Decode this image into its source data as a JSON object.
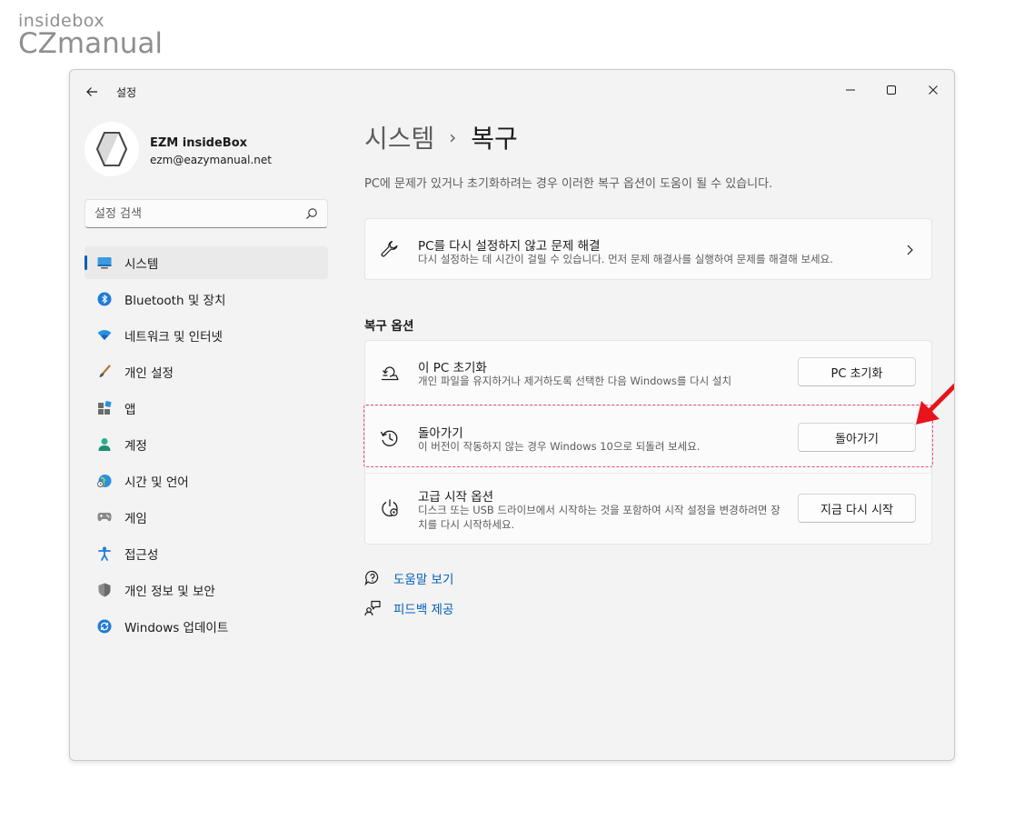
{
  "watermark": {
    "top": "insidebox",
    "bottom": "CZmanual"
  },
  "window": {
    "title": "설정"
  },
  "profile": {
    "name": "EZM insideBox",
    "email": "ezm@eazymanual.net"
  },
  "search": {
    "placeholder": "설정 검색"
  },
  "sidebar": {
    "items": [
      {
        "label": "시스템",
        "icon": "system-icon",
        "active": true
      },
      {
        "label": "Bluetooth 및 장치",
        "icon": "bluetooth-icon"
      },
      {
        "label": "네트워크 및 인터넷",
        "icon": "wifi-icon"
      },
      {
        "label": "개인 설정",
        "icon": "brush-icon"
      },
      {
        "label": "앱",
        "icon": "apps-icon"
      },
      {
        "label": "계정",
        "icon": "account-icon"
      },
      {
        "label": "시간 및 언어",
        "icon": "globe-icon"
      },
      {
        "label": "게임",
        "icon": "gamepad-icon"
      },
      {
        "label": "접근성",
        "icon": "accessibility-icon"
      },
      {
        "label": "개인 정보 및 보안",
        "icon": "shield-icon"
      },
      {
        "label": "Windows 업데이트",
        "icon": "update-icon"
      }
    ]
  },
  "main": {
    "breadcrumb_parent": "시스템",
    "breadcrumb_sep": "›",
    "breadcrumb_current": "복구",
    "description": "PC에 문제가 있거나 초기화하려는 경우 이러한 복구 옵션이 도움이 될 수 있습니다.",
    "troubleshoot": {
      "title": "PC를 다시 설정하지 않고 문제 해결",
      "subtitle": "다시 설정하는 데 시간이 걸릴 수 있습니다. 먼저 문제 해결사를 실행하여 문제를 해결해 보세요."
    },
    "recovery_header": "복구 옵션",
    "options": [
      {
        "title": "이 PC 초기화",
        "subtitle": "개인 파일을 유지하거나 제거하도록 선택한 다음 Windows를 다시 설치",
        "button": "PC 초기화"
      },
      {
        "title": "돌아가기",
        "subtitle": "이 버전이 작동하지 않는 경우 Windows 10으로 되돌려 보세요.",
        "button": "돌아가기"
      },
      {
        "title": "고급 시작 옵션",
        "subtitle": "디스크 또는 USB 드라이브에서 시작하는 것을 포함하여 시작 설정을 변경하려면 장치를 다시 시작하세요.",
        "button": "지금 다시 시작"
      }
    ],
    "links": [
      {
        "label": "도움말 보기",
        "icon": "help-icon"
      },
      {
        "label": "피드백 제공",
        "icon": "feedback-icon"
      }
    ]
  },
  "colors": {
    "accent": "#005fb8",
    "highlight": "#e2517a",
    "arrow": "#e8141b",
    "window_bg": "#f3f3f3"
  }
}
